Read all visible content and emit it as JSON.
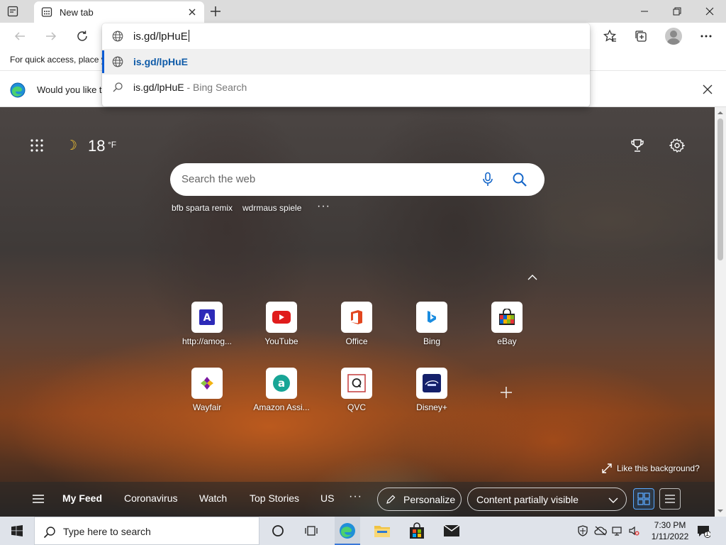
{
  "browser": {
    "tab": {
      "title": "New tab"
    },
    "omnibox": {
      "input_value": "is.gd/lpHuE",
      "suggestions": [
        {
          "text": "is.gd/lpHuE",
          "suffix": "",
          "icon": "globe-icon",
          "selected": true
        },
        {
          "text": "is.gd/lpHuE",
          "suffix": " - Bing Search",
          "icon": "search-icon",
          "selected": false
        }
      ]
    },
    "favorites_bar": {
      "text": "For quick access, place y"
    },
    "info_bar": {
      "text": "Would you like t"
    }
  },
  "newtab": {
    "weather": {
      "temp": "18",
      "unit": "°F"
    },
    "search": {
      "placeholder": "Search the web"
    },
    "trending": [
      "bfb sparta remix",
      "wdrmaus spiele"
    ],
    "tiles": [
      {
        "label": "http://amog...",
        "icon": "amog-icon"
      },
      {
        "label": "YouTube",
        "icon": "youtube-icon"
      },
      {
        "label": "Office",
        "icon": "office-icon"
      },
      {
        "label": "Bing",
        "icon": "bing-icon"
      },
      {
        "label": "eBay",
        "icon": "ebay-icon"
      },
      {
        "label": "Wayfair",
        "icon": "wayfair-icon"
      },
      {
        "label": "Amazon Assi...",
        "icon": "amazon-assistant-icon"
      },
      {
        "label": "QVC",
        "icon": "qvc-icon"
      },
      {
        "label": "Disney+",
        "icon": "disney-plus-icon"
      }
    ],
    "like_background": "Like this background?",
    "feed": {
      "items": [
        "My Feed",
        "Coronavirus",
        "Watch",
        "Top Stories",
        "US"
      ],
      "personalize": "Personalize",
      "content_visibility": "Content partially visible"
    }
  },
  "taskbar": {
    "search_placeholder": "Type here to search",
    "time": "7:30 PM",
    "date": "1/11/2022",
    "notification_count": "1"
  }
}
